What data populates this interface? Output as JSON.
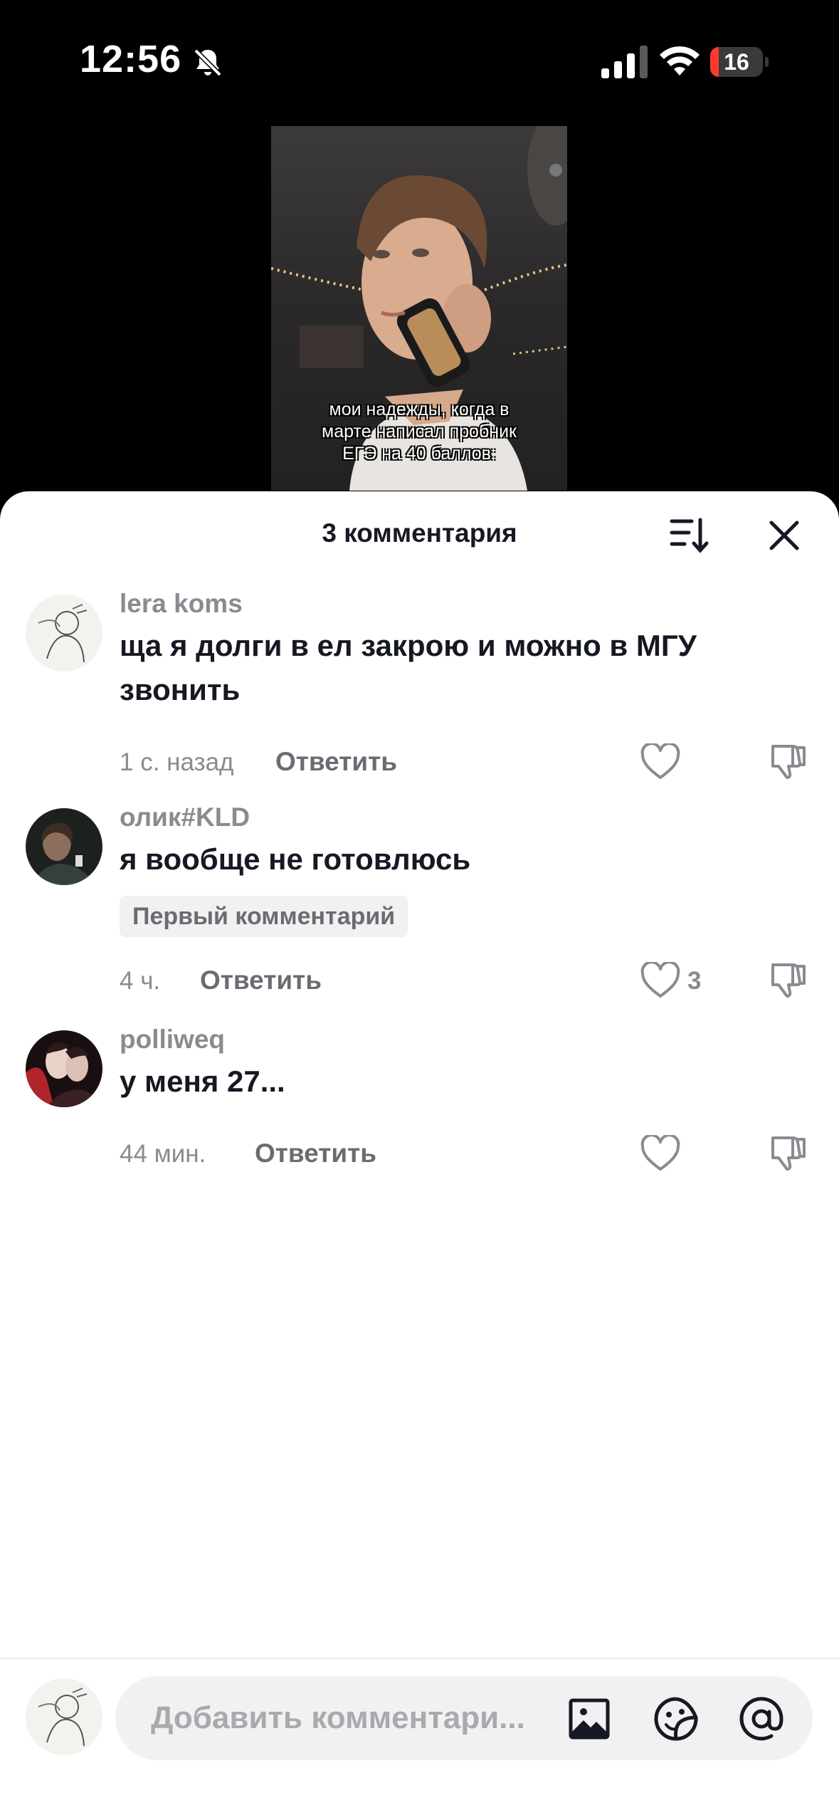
{
  "status_bar": {
    "time": "12:56",
    "battery_level": "16",
    "battery_fraction": 0.16
  },
  "video": {
    "caption": "мои надежды, когда в марте написал пробник ЕГЭ на 40 баллов:"
  },
  "sheet": {
    "title": "3 комментария"
  },
  "comments": [
    {
      "username": "lera koms",
      "text": "ща я долги в ел закрою и можно в МГУ звонить",
      "time": "1 с. назад",
      "reply_label": "Ответить",
      "likes": ""
    },
    {
      "username": "олик#KLD",
      "text": "я вообще не готовлюсь",
      "badge": "Первый комментарий",
      "time": "4 ч.",
      "reply_label": "Ответить",
      "likes": "3"
    },
    {
      "username": "polliweq",
      "text": "у меня 27...",
      "time": "44 мин.",
      "reply_label": "Ответить",
      "likes": ""
    }
  ],
  "composer": {
    "placeholder": "Добавить комментари..."
  },
  "colors": {
    "primary_text": "#161823",
    "secondary_text": "#8a8b91",
    "battery_red": "#ff3b30"
  }
}
